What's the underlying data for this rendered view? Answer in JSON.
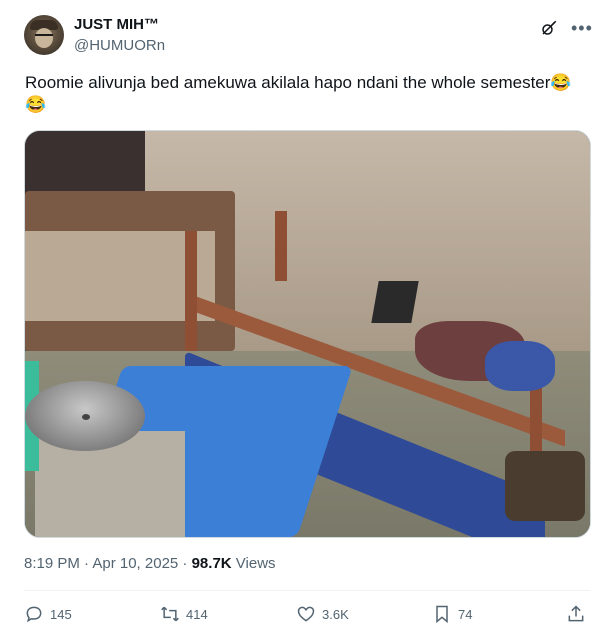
{
  "author": {
    "display_name": "JUST MIH™",
    "handle": "@HUMUORn"
  },
  "post": {
    "text": "Roomie alivunja bed amekuwa akilala hapo ndani the whole semester😂😂",
    "time": "8:19 PM · Apr 10, 2025 · ",
    "views_count": "98.7K",
    "views_label": " Views"
  },
  "actions": {
    "replies": "145",
    "reposts": "414",
    "likes": "3.6K",
    "bookmarks": "74"
  },
  "icons": {
    "grok": "grok-icon",
    "more": "more-icon",
    "reply": "reply-icon",
    "repost": "repost-icon",
    "like": "heart-icon",
    "bookmark": "bookmark-icon",
    "share": "share-icon"
  },
  "colors": {
    "text_primary": "#0f1419",
    "text_secondary": "#536471",
    "border": "#cfd9de"
  }
}
